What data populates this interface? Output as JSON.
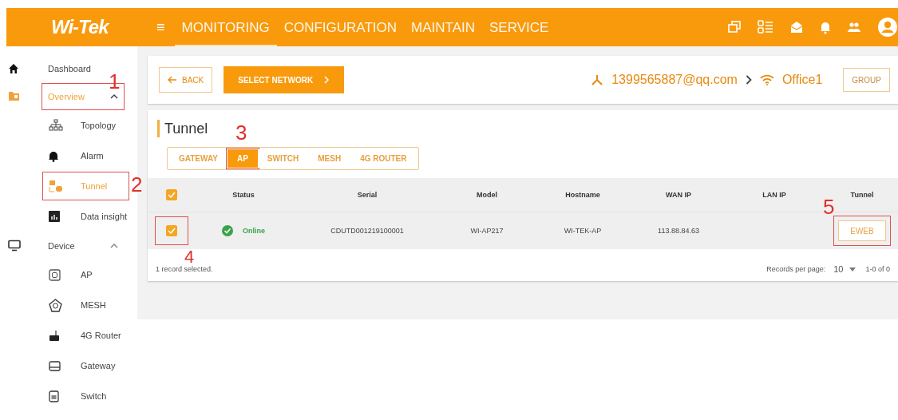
{
  "header": {
    "logo": "Wi-Tek",
    "menu_icon": "≡",
    "nav": [
      {
        "label": "MONITORING",
        "selected": true
      },
      {
        "label": "CONFIGURATION",
        "selected": false
      },
      {
        "label": "MAINTAIN",
        "selected": false
      },
      {
        "label": "SERVICE",
        "selected": false
      }
    ]
  },
  "sidebar": {
    "items": [
      {
        "kind": "link",
        "label": "Dashboard",
        "selected": false
      },
      {
        "kind": "group",
        "label": "Overview",
        "selected": true,
        "expanded": true,
        "callout": "1",
        "children": [
          {
            "label": "Topology",
            "selected": false
          },
          {
            "label": "Alarm",
            "selected": false
          },
          {
            "label": "Tunnel",
            "selected": true,
            "callout": "2"
          },
          {
            "label": "Data insight",
            "selected": false
          }
        ]
      },
      {
        "kind": "group",
        "label": "Device",
        "selected": false,
        "expanded": true,
        "children": [
          {
            "label": "AP",
            "selected": false
          },
          {
            "label": "MESH",
            "selected": false
          },
          {
            "label": "4G Router",
            "selected": false
          },
          {
            "label": "Gateway",
            "selected": false
          },
          {
            "label": "Switch",
            "selected": false
          }
        ]
      }
    ]
  },
  "toolbar": {
    "back": "BACK",
    "select_network": "SELECT NETWORK",
    "account": "1399565887@qq.com",
    "network": "Office1",
    "group": "GROUP"
  },
  "panel": {
    "title": "Tunnel",
    "tabs": [
      {
        "label": "GATEWAY",
        "selected": false
      },
      {
        "label": "AP",
        "selected": true,
        "callout": "3"
      },
      {
        "label": "SWITCH",
        "selected": false
      },
      {
        "label": "MESH",
        "selected": false
      },
      {
        "label": "4G ROUTER",
        "selected": false
      }
    ],
    "table": {
      "all_checked": true,
      "columns": [
        "Status",
        "Serial",
        "Model",
        "Hostname",
        "WAN IP",
        "LAN IP",
        "Tunnel"
      ],
      "rows": [
        {
          "checked": true,
          "checkbox_callout": "4",
          "status": "Online",
          "online": true,
          "serial": "CDUTD001219100001",
          "model": "WI-AP217",
          "hostname": "WI-TEK-AP",
          "wan_ip": "113.88.84.63",
          "tunnel": "EWEB",
          "tunnel_callout": "5"
        }
      ]
    },
    "footer": {
      "selected_note": "1 record selected.",
      "per_page_label": "Records per page:",
      "per_page": "10",
      "range": "1-0 of 0"
    }
  }
}
